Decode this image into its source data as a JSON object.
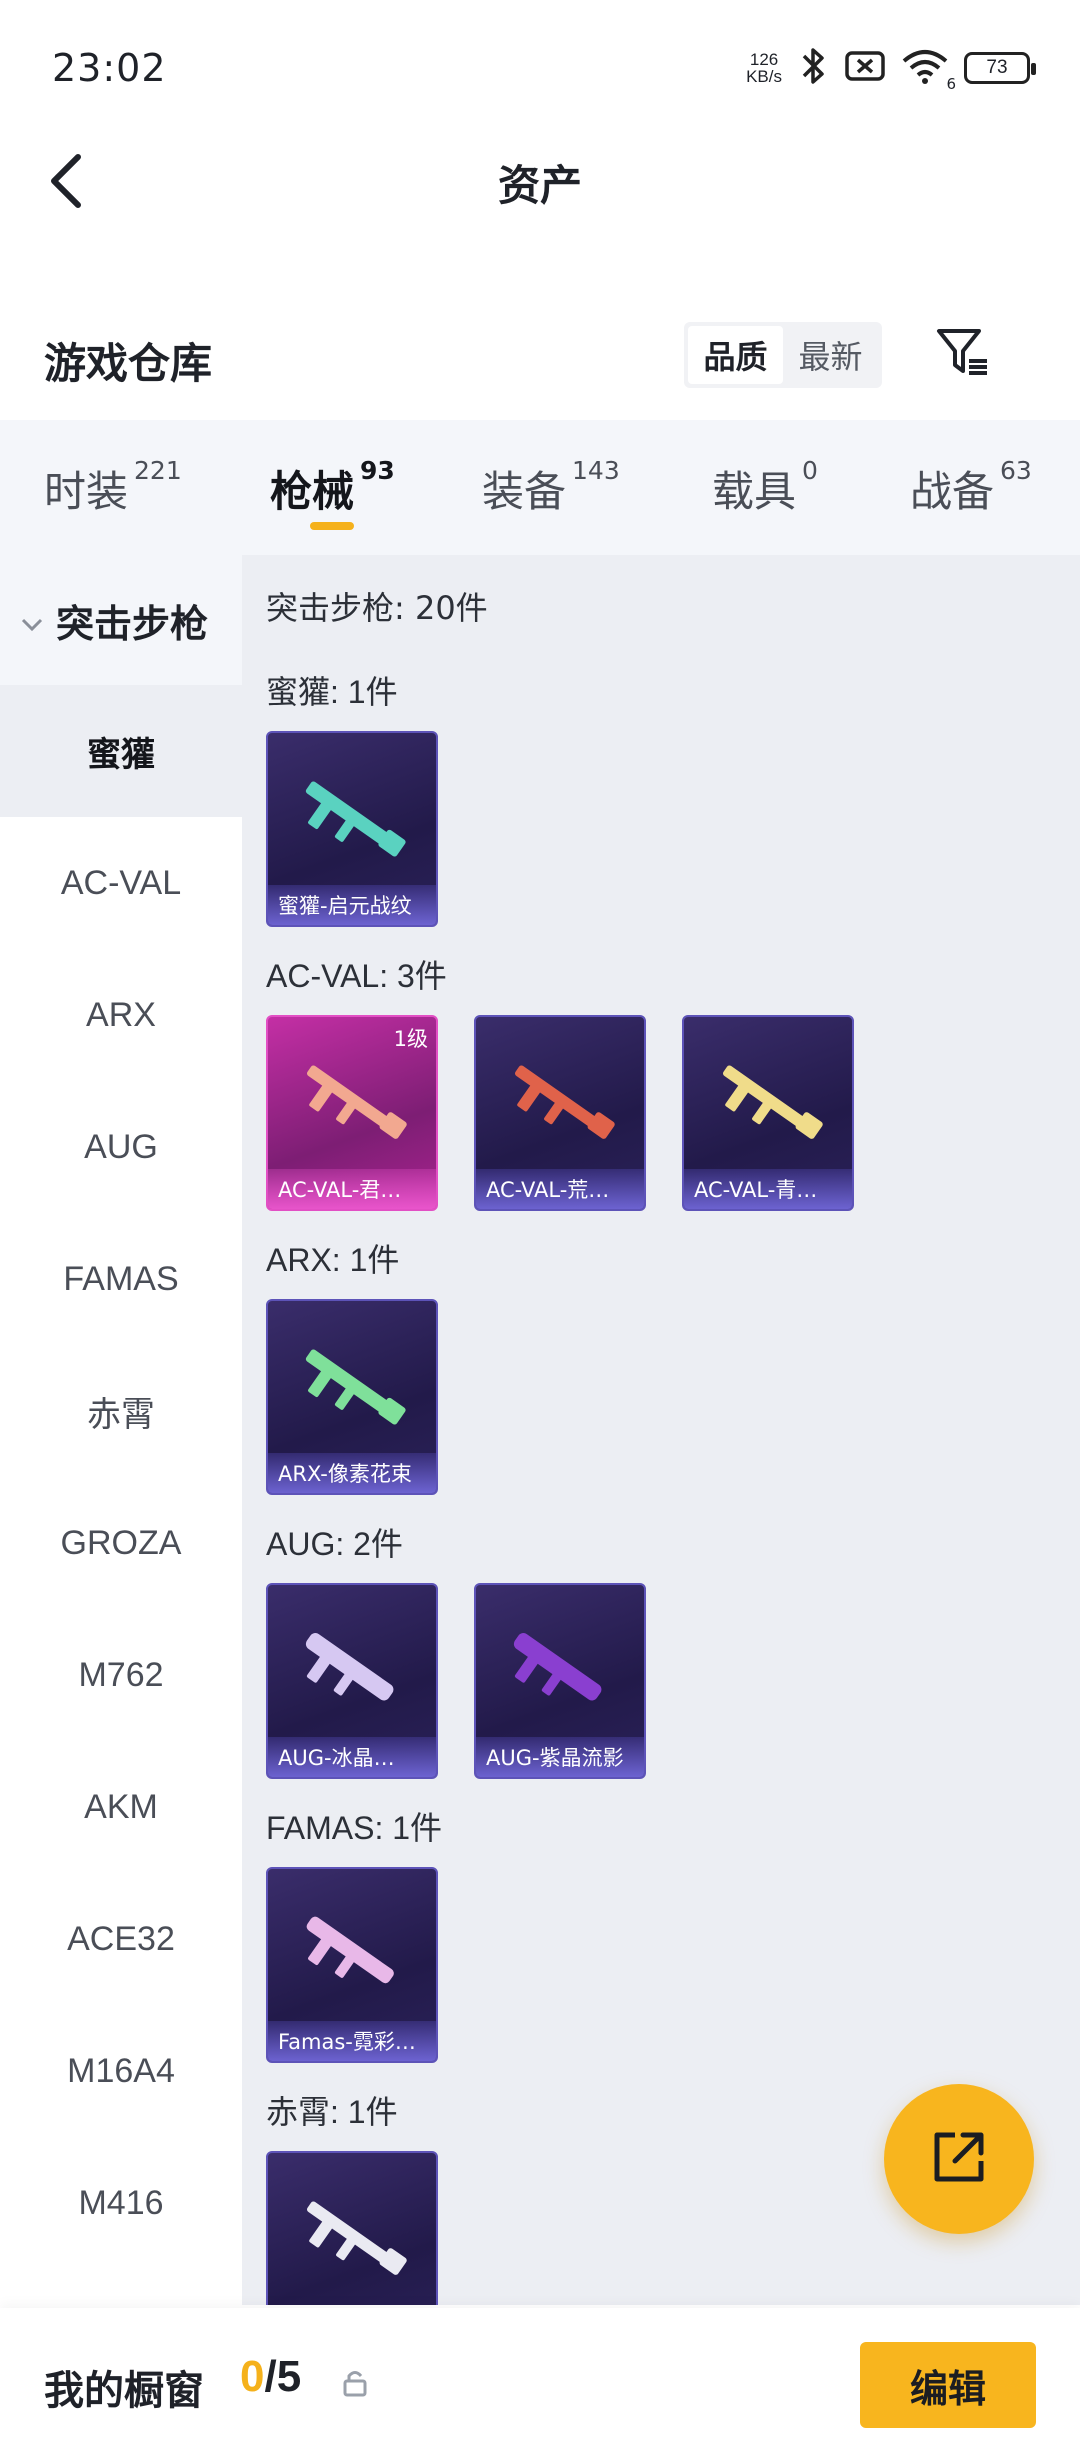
{
  "status_bar": {
    "time": "23:02",
    "net_speed_value": "126",
    "net_speed_unit": "KB/s",
    "wifi_label": "6",
    "battery": "73"
  },
  "nav": {
    "title": "资产"
  },
  "header": {
    "title": "游戏仓库",
    "sort_options": [
      "品质",
      "最新"
    ],
    "sort_selected": "品质"
  },
  "tabs": [
    {
      "label": "时装",
      "count": "221",
      "active": false
    },
    {
      "label": "枪械",
      "count": "93",
      "active": true
    },
    {
      "label": "装备",
      "count": "143",
      "active": false
    },
    {
      "label": "载具",
      "count": "0",
      "active": false
    },
    {
      "label": "战备",
      "count": "63",
      "active": false
    }
  ],
  "sidebar": {
    "group": "突击步枪",
    "items": [
      "蜜獾",
      "AC-VAL",
      "ARX",
      "AUG",
      "FAMAS",
      "赤霄",
      "GROZA",
      "M762",
      "AKM",
      "ACE32",
      "M16A4",
      "M416"
    ],
    "selected": "蜜獾"
  },
  "main": {
    "summary": "突击步枪: 20件",
    "groups": [
      {
        "label": "蜜獾: 1件",
        "cards": [
          {
            "name": "蜜獾-启元战纹",
            "level": "",
            "color": "#5ad2c0"
          }
        ]
      },
      {
        "label": "AC-VAL: 3件",
        "cards": [
          {
            "name": "AC-VAL-君…",
            "level": "1级",
            "color": "#f2a890"
          },
          {
            "name": "AC-VAL-荒…",
            "level": "",
            "color": "#e0624a"
          },
          {
            "name": "AC-VAL-青…",
            "level": "",
            "color": "#f0dc8a"
          }
        ]
      },
      {
        "label": "ARX: 1件",
        "cards": [
          {
            "name": "ARX-像素花束",
            "level": "",
            "color": "#7fe09a"
          }
        ]
      },
      {
        "label": "AUG: 2件",
        "cards": [
          {
            "name": "AUG-冰晶…",
            "level": "",
            "color": "#d6c8f2"
          },
          {
            "name": "AUG-紫晶流影",
            "level": "",
            "color": "#8a3fd0"
          }
        ]
      },
      {
        "label": "FAMAS: 1件",
        "cards": [
          {
            "name": "Famas-霓彩…",
            "level": "",
            "color": "#e8b8e8"
          }
        ]
      },
      {
        "label": "赤霄: 1件",
        "cards": [
          {
            "name": "",
            "level": "",
            "color": "#eaeaf2"
          }
        ]
      }
    ]
  },
  "bottom": {
    "showcase_label": "我的橱窗",
    "showcase_current": "0",
    "showcase_total": "/5",
    "edit_label": "编辑"
  },
  "colors": {
    "accent": "#f8b51e",
    "card_purple": "#2a2158",
    "card_pink": "#c42fa5"
  }
}
